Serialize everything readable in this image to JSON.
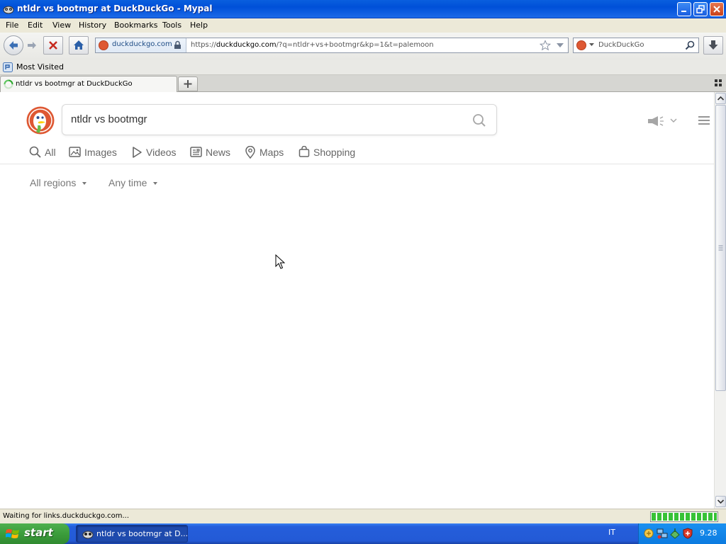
{
  "window": {
    "title": "ntldr vs bootmgr at DuckDuckGo - Mypal"
  },
  "menu": {
    "items": [
      "File",
      "Edit",
      "View",
      "History",
      "Bookmarks",
      "Tools",
      "Help"
    ]
  },
  "navbar": {
    "identity_host": "duckduckgo.com",
    "url_prefix": "https://",
    "url_domain": "duckduckgo.com",
    "url_rest": "/?q=ntldr+vs+bootmgr&kp=1&t=palemoon",
    "search_engine": "DuckDuckGo"
  },
  "bookmarks": {
    "most_visited": "Most Visited"
  },
  "tabs": [
    {
      "title": "ntldr vs bootmgr at DuckDuckGo"
    }
  ],
  "page": {
    "query": "ntldr vs bootmgr",
    "nav_tabs": [
      "All",
      "Images",
      "Videos",
      "News",
      "Maps",
      "Shopping"
    ],
    "filters": {
      "region": "All regions",
      "time": "Any time"
    }
  },
  "status": {
    "text": "Waiting for links.duckduckgo.com..."
  },
  "taskbar": {
    "start_label": "start",
    "task_label": "ntldr vs bootmgr at D...",
    "language": "IT",
    "clock": "9.28"
  },
  "colors": {
    "ddg_orange": "#de5833",
    "xp_blue": "#245edb",
    "start_green": "#3c9d3c",
    "progress_green": "#37c237"
  },
  "icons": [
    "back-arrow-icon",
    "forward-arrow-icon",
    "stop-icon",
    "home-icon",
    "lock-icon",
    "star-icon",
    "search-icon",
    "download-icon",
    "throbber-icon",
    "megaphone-icon",
    "hamburger-icon",
    "windows-flag-icon"
  ]
}
